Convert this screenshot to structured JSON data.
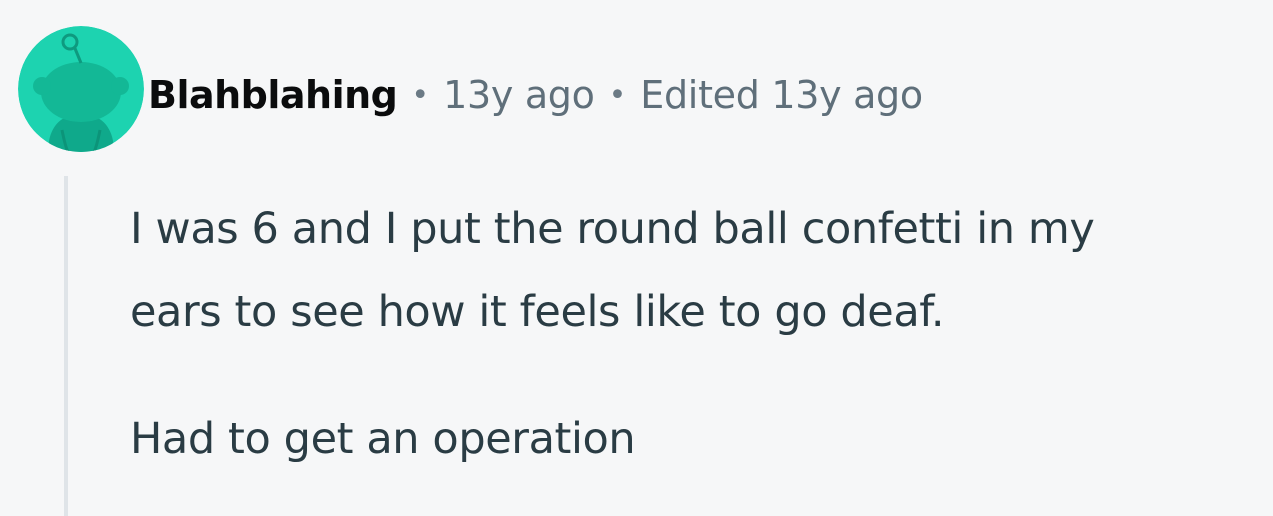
{
  "comment": {
    "author": "Blahblahing",
    "separator": "•",
    "posted": "13y ago",
    "edited": "Edited 13y ago",
    "avatar_icon": "snoo-avatar-icon",
    "avatar_color": "#1dd3b0",
    "body_lines": [
      "I was 6 and I put the round ball confetti in my",
      "ears to see how it feels like to go deaf.",
      "Had to get an operation"
    ]
  }
}
